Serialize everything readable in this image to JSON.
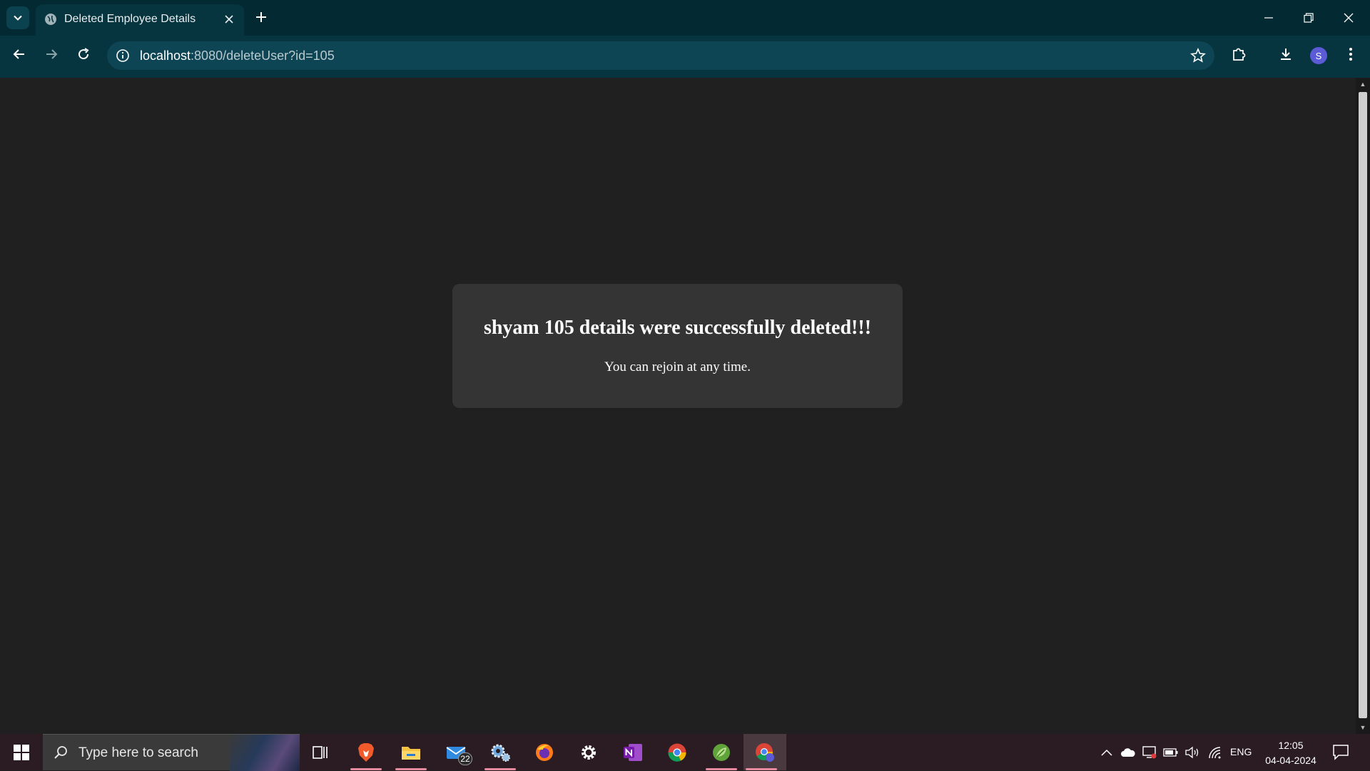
{
  "browser": {
    "tab_title": "Deleted Employee Details",
    "url_host": "localhost",
    "url_rest": ":8080/deleteUser?id=105",
    "profile_initial": "S"
  },
  "page": {
    "message_title": "shyam 105 details were successfully deleted!!!",
    "message_subtitle": "You can rejoin at any time."
  },
  "taskbar": {
    "search_placeholder": "Type here to search",
    "mail_badge": "22",
    "language": "ENG",
    "time": "12:05",
    "date": "04-04-2024",
    "apps": [
      "task-view",
      "brave",
      "file-explorer",
      "mail",
      "control-panel",
      "firefox",
      "settings",
      "onenote",
      "chrome",
      "spring-tool-suite",
      "chrome-profile"
    ]
  },
  "colors": {
    "chrome_bg": "#06343f",
    "page_bg": "#202020",
    "card_bg": "#343434",
    "taskbar_bg": "#2a1c22"
  }
}
